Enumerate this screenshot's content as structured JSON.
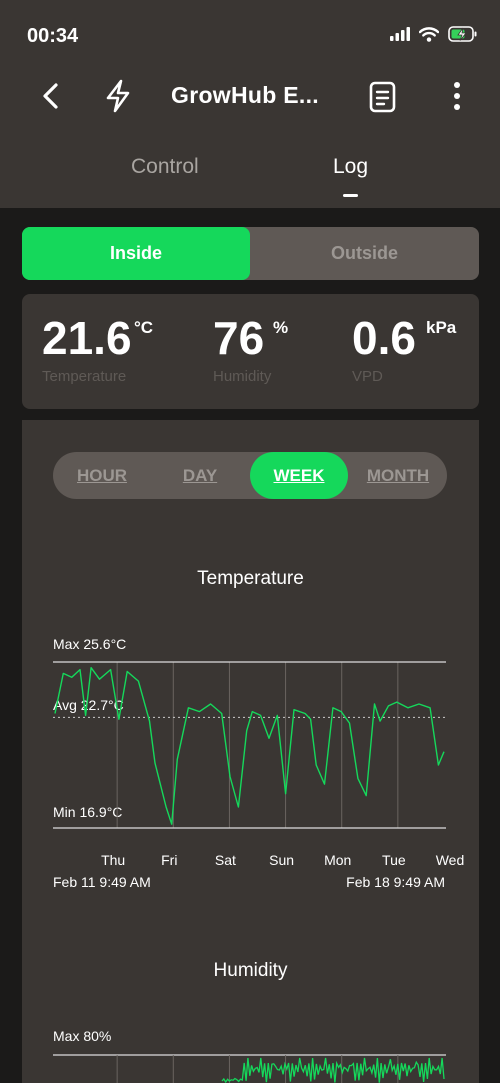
{
  "status_bar": {
    "time": "00:34"
  },
  "header": {
    "title": "GrowHub E..."
  },
  "tabs": [
    {
      "label": "Control",
      "active": false
    },
    {
      "label": "Log",
      "active": true
    }
  ],
  "location_toggle": {
    "options": [
      "Inside",
      "Outside"
    ],
    "selected": "Inside"
  },
  "readings": [
    {
      "value": "21.6",
      "unit": "°C",
      "label": "Temperature"
    },
    {
      "value": "76",
      "unit": "%",
      "label": "Humidity"
    },
    {
      "value": "0.6",
      "unit": "kPa",
      "label": "VPD"
    }
  ],
  "time_range": {
    "options": [
      "HOUR",
      "DAY",
      "WEEK",
      "MONTH"
    ],
    "selected": "WEEK"
  },
  "colors": {
    "accent": "#15d85b",
    "panel": "#3a3633",
    "background": "#1b1a19"
  },
  "chart_data": [
    {
      "type": "line",
      "title": "Temperature",
      "max_label": "Max 25.6°C",
      "avg_label": "Avg 22.7°C",
      "min_label": "Min 16.9°C",
      "ylim": [
        16.9,
        25.6
      ],
      "avg": 22.7,
      "day_labels": [
        "Thu",
        "Fri",
        "Sat",
        "Sun",
        "Mon",
        "Tue",
        "Wed"
      ],
      "start_label": "Feb 11 9:49 AM",
      "end_label": "Feb 18 9:49 AM",
      "x_days": [
        0,
        0.15,
        0.3,
        0.45,
        0.55,
        0.65,
        0.8,
        1,
        1.15,
        1.3,
        1.5,
        1.7,
        1.8,
        2,
        2.1,
        2.2,
        2.4,
        2.6,
        2.8,
        3,
        3.15,
        3.3,
        3.45,
        3.55,
        3.7,
        3.85,
        4,
        4.15,
        4.3,
        4.5,
        4.6,
        4.7,
        4.85,
        5,
        5.15,
        5.3,
        5.45,
        5.6,
        5.75,
        5.85,
        6,
        6.15,
        6.35,
        6.55,
        6.75,
        6.9,
        7
      ],
      "values": [
        22.9,
        25.0,
        24.8,
        25.2,
        22.8,
        25.3,
        24.7,
        25.2,
        22.6,
        25.1,
        24.6,
        22.5,
        20.3,
        18.0,
        17.1,
        20.5,
        23.2,
        23.0,
        23.4,
        22.9,
        19.6,
        18.0,
        22.0,
        23.0,
        22.8,
        21.6,
        22.8,
        18.7,
        23.1,
        22.9,
        22.6,
        20.2,
        19.2,
        23.2,
        23.0,
        22.4,
        19.5,
        18.6,
        23.4,
        22.5,
        23.3,
        23.5,
        23.2,
        23.4,
        23.2,
        20.2,
        20.9
      ]
    },
    {
      "type": "line",
      "title": "Humidity",
      "max_label": "Max 80%"
    }
  ]
}
